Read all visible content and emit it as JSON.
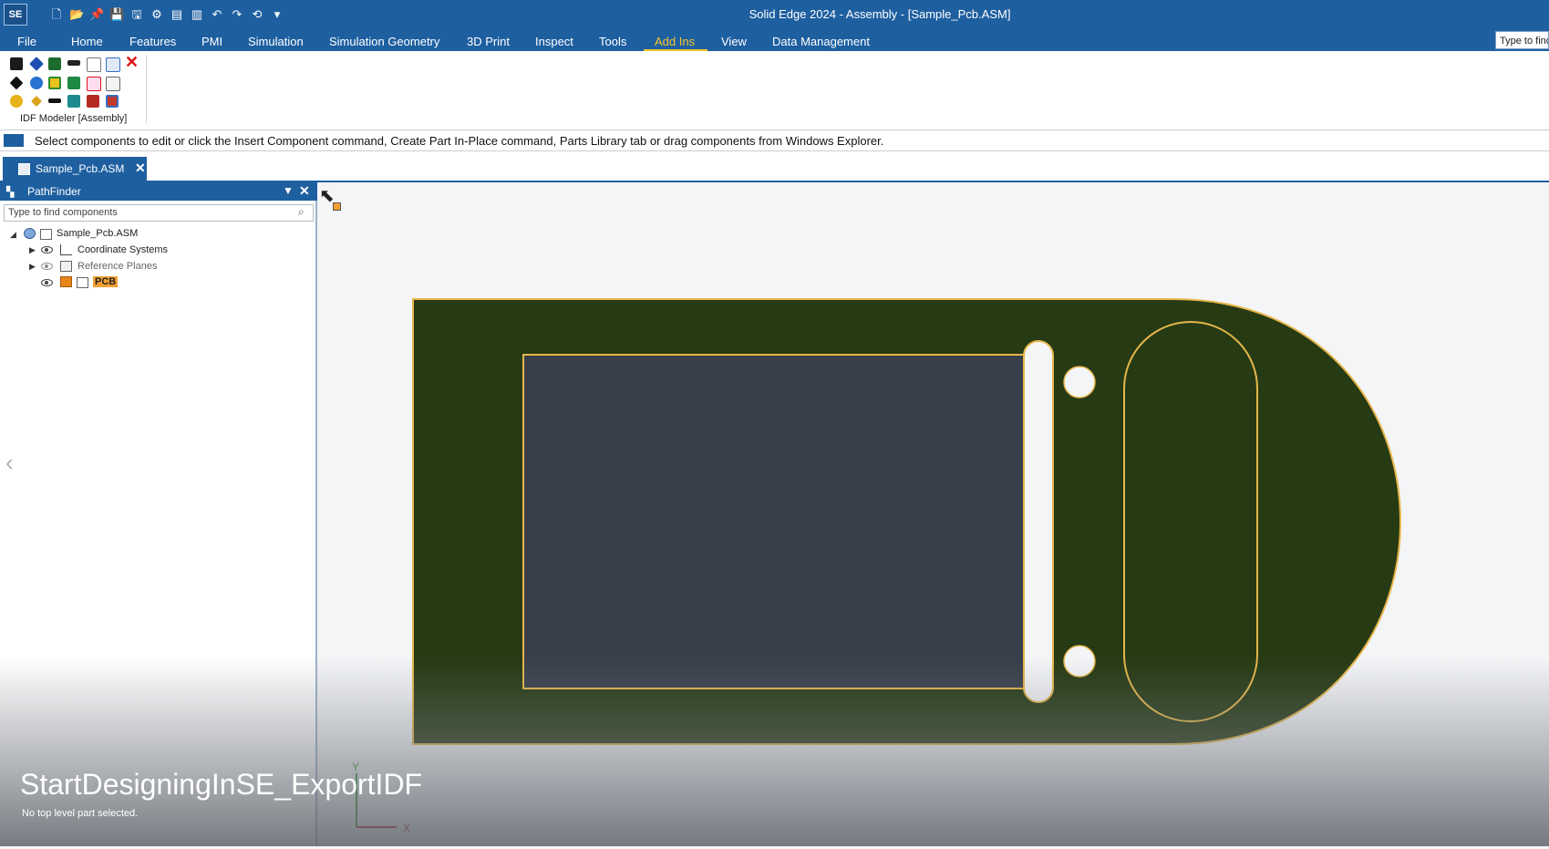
{
  "app": {
    "logo": "SE",
    "window_title": "Solid Edge 2024 - Assembly - [Sample_Pcb.ASM]"
  },
  "quick_access_icons": [
    "new-file-icon",
    "open-icon",
    "pin-icon",
    "save-icon",
    "save-as-icon",
    "settings-icon",
    "toolbar-icon",
    "layout-icon",
    "undo-icon",
    "redo-icon",
    "repeat-icon",
    "customize-icon"
  ],
  "menu": {
    "file": "File",
    "tabs": [
      "Home",
      "Features",
      "PMI",
      "Simulation",
      "Simulation Geometry",
      "3D Print",
      "Inspect",
      "Tools",
      "Add Ins",
      "View",
      "Data Management"
    ],
    "active_tab": "Add Ins",
    "active_color": "#f4c430",
    "search_placeholder": "Type to find"
  },
  "ribbon": {
    "group_label": "IDF Modeler [Assembly]"
  },
  "prompt": {
    "text": "Select components to edit or click the Insert Component command, Create Part In-Place command, Parts Library tab or drag components from Windows Explorer."
  },
  "document_tab": {
    "label": "Sample_Pcb.ASM"
  },
  "pathfinder": {
    "title": "PathFinder",
    "search_placeholder": "Type to find components",
    "tree": {
      "root": "Sample_Pcb.ASM",
      "coordinate_systems": "Coordinate Systems",
      "reference_planes": "Reference Planes",
      "pcb": "PCB"
    }
  },
  "viewport": {
    "board_color": "#263a14",
    "edge_color": "#e6b64a",
    "display_color": "#383f4a",
    "axis_y": "Y",
    "axis_x": "X"
  },
  "overlay": {
    "watermark": "StartDesigningInSE_ExportIDF",
    "status": "No top level part selected."
  }
}
